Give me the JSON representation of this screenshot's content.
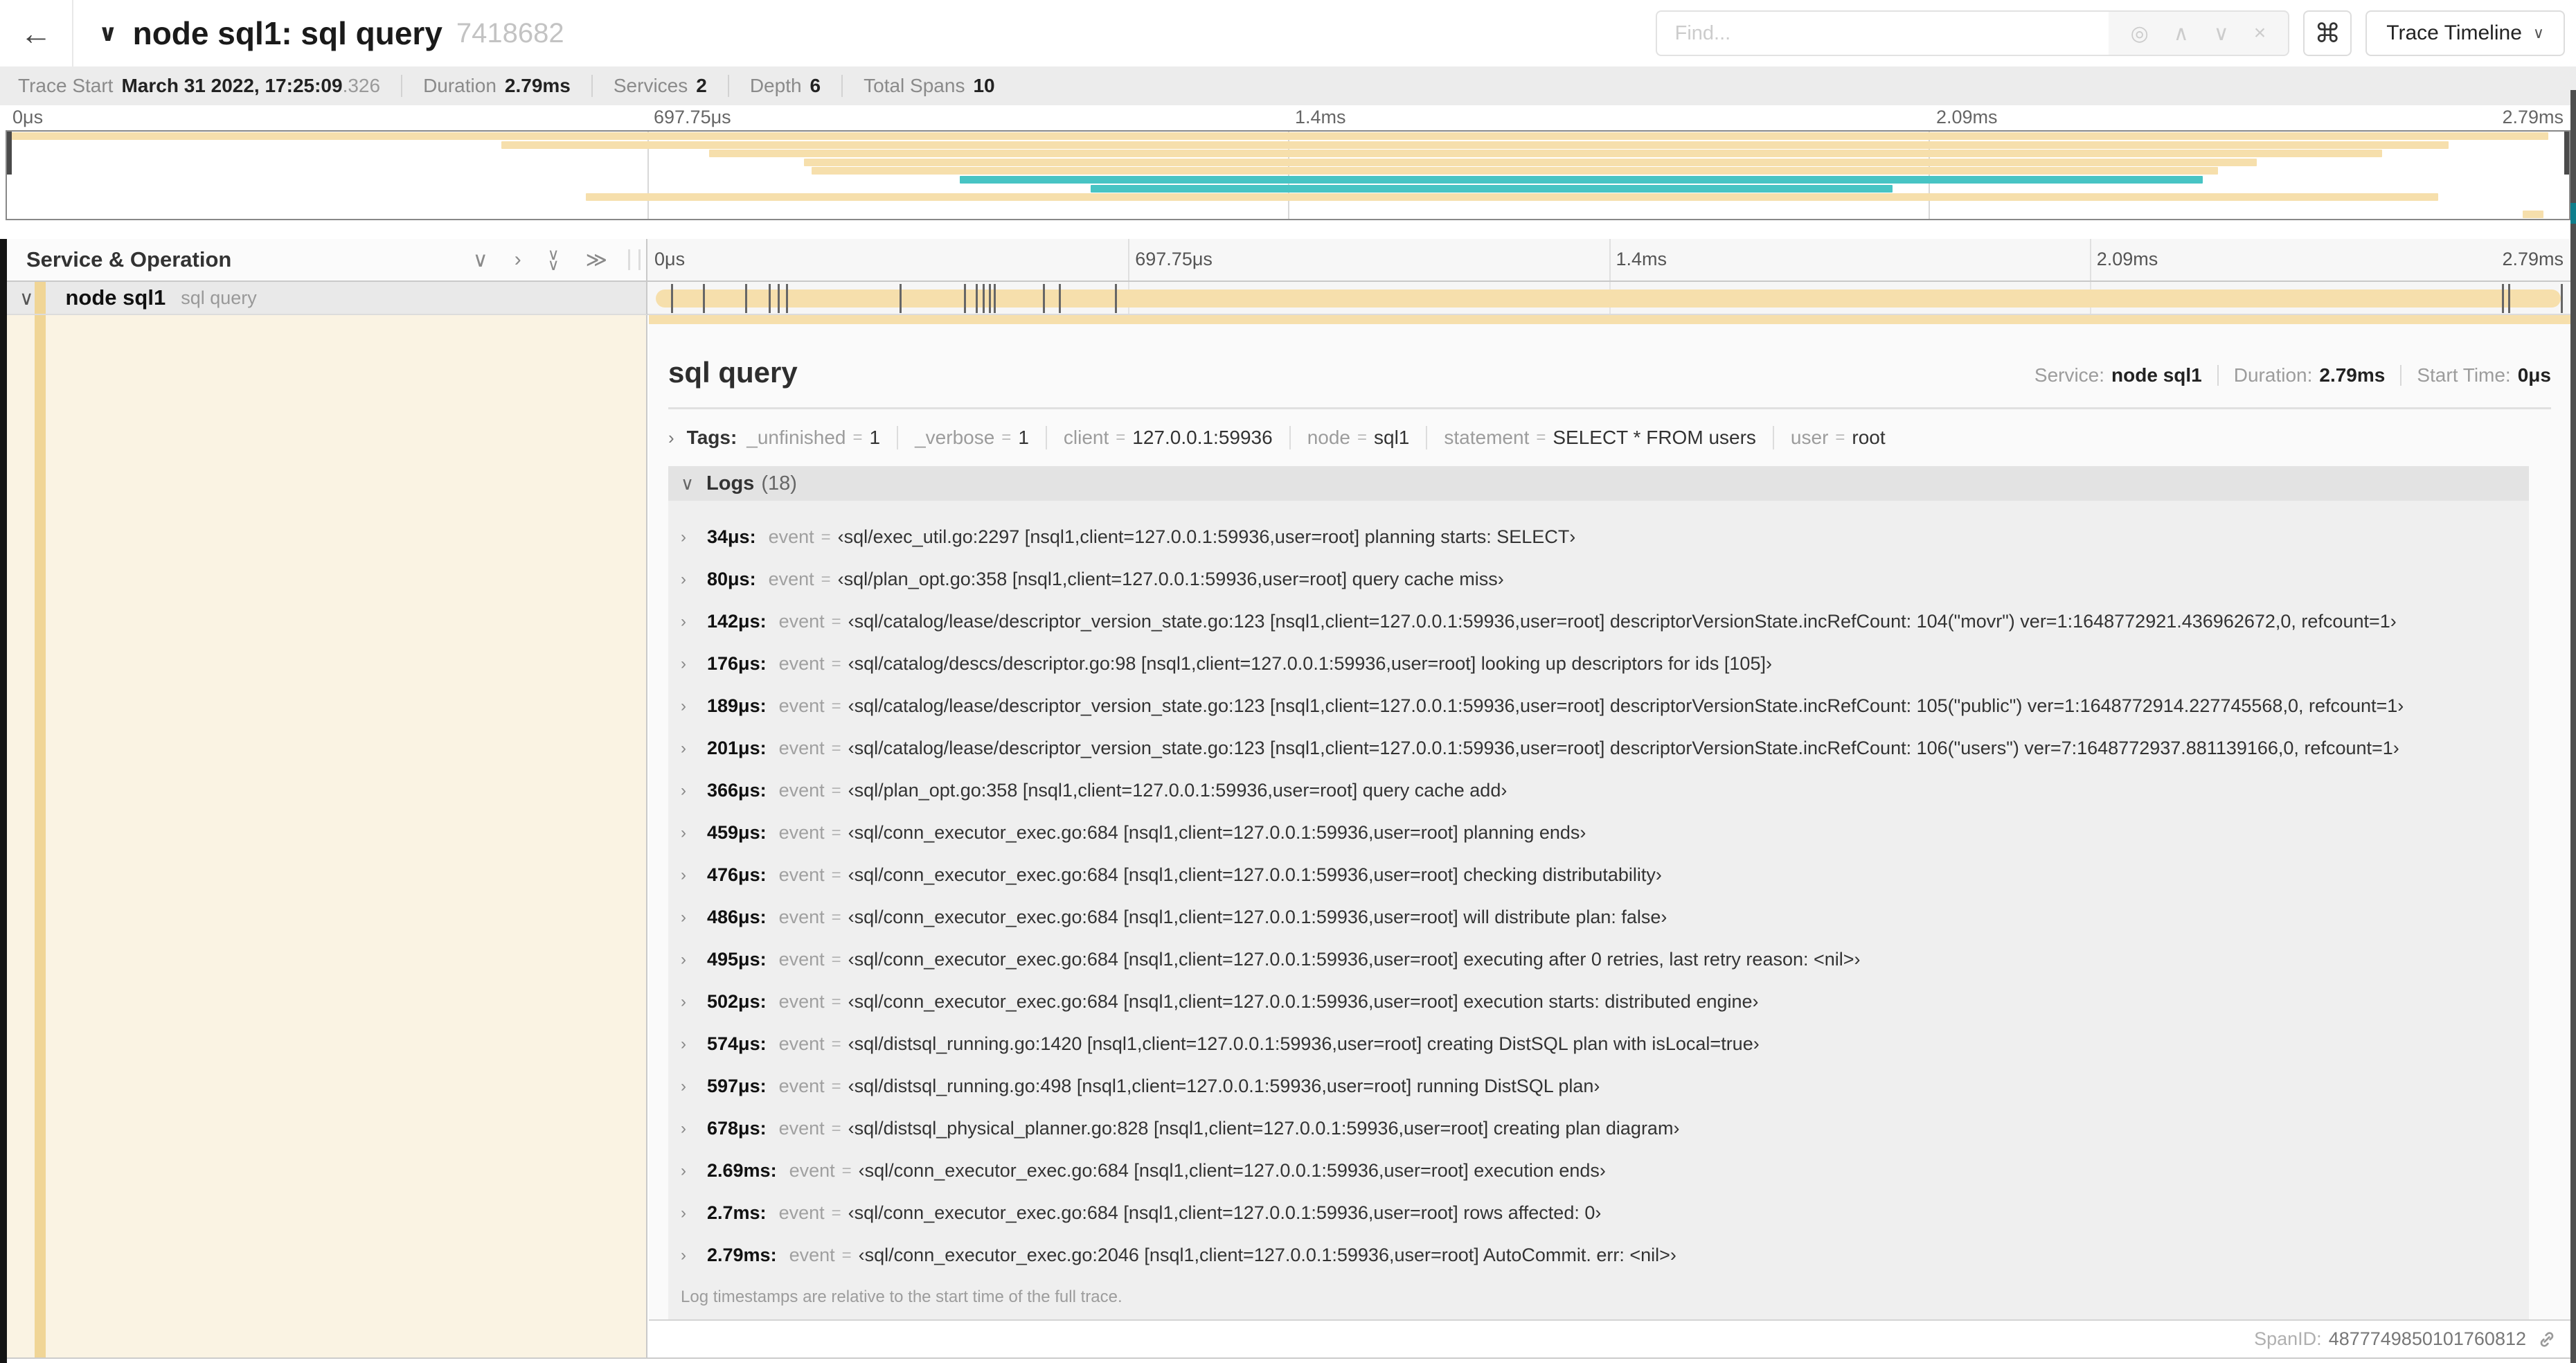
{
  "colors": {
    "tan": "#F6DFAC",
    "teal": "#47C4C4",
    "accent": "#F0D596",
    "cream": "#FAF3E3"
  },
  "header": {
    "back_icon": "←",
    "collapse_icon": "∨",
    "title": "node sql1: sql query",
    "trace_id": "7418682",
    "find_placeholder": "Find...",
    "icons": {
      "locate": "◎",
      "prev": "∧",
      "next": "∨",
      "clear": "×",
      "shortcut": "⌘"
    },
    "view_select": "Trace Timeline",
    "view_caret": "∨"
  },
  "stats": [
    {
      "label": "Trace Start",
      "value": "March 31 2022, 17:25:09",
      "suffix": ".326"
    },
    {
      "label": "Duration",
      "value": "2.79ms",
      "suffix": ""
    },
    {
      "label": "Services",
      "value": "2",
      "suffix": ""
    },
    {
      "label": "Depth",
      "value": "6",
      "suffix": ""
    },
    {
      "label": "Total Spans",
      "value": "10",
      "suffix": ""
    }
  ],
  "timeline": {
    "labels": [
      {
        "label": "0μs",
        "pct": 0
      },
      {
        "label": "697.75μs",
        "pct": 25
      },
      {
        "label": "1.4ms",
        "pct": 50
      },
      {
        "label": "2.09ms",
        "pct": 75
      },
      {
        "label": "2.79ms",
        "pct": 100
      }
    ],
    "grid": [
      {
        "pct": 25
      },
      {
        "pct": 50
      },
      {
        "pct": 75
      }
    ],
    "column_header": "Service & Operation",
    "icons": {
      "chevron_down": "∨",
      "chevron_right": "›",
      "double_chevron_right": "≫"
    }
  },
  "minimap": {
    "bars": [
      {
        "row": 0,
        "s": 0,
        "e": 99.2,
        "c": "tan"
      },
      {
        "row": 1,
        "s": 19.3,
        "e": 95.3,
        "c": "tan"
      },
      {
        "row": 2,
        "s": 27.4,
        "e": 92.7,
        "c": "tan"
      },
      {
        "row": 3,
        "s": 31.1,
        "e": 87.8,
        "c": "tan"
      },
      {
        "row": 4,
        "s": 31.4,
        "e": 86.3,
        "c": "tan"
      },
      {
        "row": 5,
        "s": 37.2,
        "e": 85.7,
        "c": "teal"
      },
      {
        "row": 6,
        "s": 42.3,
        "e": 73.6,
        "c": "teal"
      },
      {
        "row": 7,
        "s": 22.6,
        "e": 94.9,
        "c": "tan"
      },
      {
        "row": 9,
        "s": 98.2,
        "e": 99.0,
        "c": "tan"
      }
    ]
  },
  "span_row": {
    "chevron": "∨",
    "service": "node sql1",
    "operation": "sql query",
    "log_marks": [
      {
        "pct": 1.22
      },
      {
        "pct": 2.87
      },
      {
        "pct": 5.09
      },
      {
        "pct": 6.31
      },
      {
        "pct": 6.77
      },
      {
        "pct": 7.2
      },
      {
        "pct": 13.12
      },
      {
        "pct": 16.45
      },
      {
        "pct": 17.06
      },
      {
        "pct": 17.42
      },
      {
        "pct": 17.74
      },
      {
        "pct": 17.99
      },
      {
        "pct": 20.57
      },
      {
        "pct": 21.4
      },
      {
        "pct": 24.3
      },
      {
        "pct": 96.42
      },
      {
        "pct": 96.77
      },
      {
        "pct": 99.5
      }
    ]
  },
  "detail": {
    "title": "sql query",
    "stats": [
      {
        "label": "Service:",
        "value": "node sql1"
      },
      {
        "label": "Duration:",
        "value": "2.79ms"
      },
      {
        "label": "Start Time:",
        "value": "0μs"
      }
    ],
    "tags_chevron": "›",
    "tags_label": "Tags:",
    "tags": [
      {
        "k": "_unfinished",
        "eq": "=",
        "v": "1"
      },
      {
        "k": "_verbose",
        "eq": "=",
        "v": "1"
      },
      {
        "k": "client",
        "eq": "=",
        "v": "127.0.0.1:59936"
      },
      {
        "k": "node",
        "eq": "=",
        "v": "sql1"
      },
      {
        "k": "statement",
        "eq": "=",
        "v": "SELECT * FROM users"
      },
      {
        "k": "user",
        "eq": "=",
        "v": "root"
      }
    ],
    "logs_chevron": "∨",
    "logs_label": "Logs",
    "logs_count": "(18)",
    "log_key": "event",
    "logs": [
      {
        "t": "34μs:",
        "k": "event",
        "eq": "=",
        "v": "‹sql/exec_util.go:2297 [nsql1,client=127.0.0.1:59936,user=root] planning starts: SELECT›"
      },
      {
        "t": "80μs:",
        "k": "event",
        "eq": "=",
        "v": "‹sql/plan_opt.go:358 [nsql1,client=127.0.0.1:59936,user=root] query cache miss›"
      },
      {
        "t": "142μs:",
        "k": "event",
        "eq": "=",
        "v": "‹sql/catalog/lease/descriptor_version_state.go:123 [nsql1,client=127.0.0.1:59936,user=root] descriptorVersionState.incRefCount: 104(\"movr\") ver=1:1648772921.436962672,0, refcount=1›"
      },
      {
        "t": "176μs:",
        "k": "event",
        "eq": "=",
        "v": "‹sql/catalog/descs/descriptor.go:98 [nsql1,client=127.0.0.1:59936,user=root] looking up descriptors for ids [105]›"
      },
      {
        "t": "189μs:",
        "k": "event",
        "eq": "=",
        "v": "‹sql/catalog/lease/descriptor_version_state.go:123 [nsql1,client=127.0.0.1:59936,user=root] descriptorVersionState.incRefCount: 105(\"public\") ver=1:1648772914.227745568,0, refcount=1›"
      },
      {
        "t": "201μs:",
        "k": "event",
        "eq": "=",
        "v": "‹sql/catalog/lease/descriptor_version_state.go:123 [nsql1,client=127.0.0.1:59936,user=root] descriptorVersionState.incRefCount: 106(\"users\") ver=7:1648772937.881139166,0, refcount=1›"
      },
      {
        "t": "366μs:",
        "k": "event",
        "eq": "=",
        "v": "‹sql/plan_opt.go:358 [nsql1,client=127.0.0.1:59936,user=root] query cache add›"
      },
      {
        "t": "459μs:",
        "k": "event",
        "eq": "=",
        "v": "‹sql/conn_executor_exec.go:684 [nsql1,client=127.0.0.1:59936,user=root] planning ends›"
      },
      {
        "t": "476μs:",
        "k": "event",
        "eq": "=",
        "v": "‹sql/conn_executor_exec.go:684 [nsql1,client=127.0.0.1:59936,user=root] checking distributability›"
      },
      {
        "t": "486μs:",
        "k": "event",
        "eq": "=",
        "v": "‹sql/conn_executor_exec.go:684 [nsql1,client=127.0.0.1:59936,user=root] will distribute plan: false›"
      },
      {
        "t": "495μs:",
        "k": "event",
        "eq": "=",
        "v": "‹sql/conn_executor_exec.go:684 [nsql1,client=127.0.0.1:59936,user=root] executing after 0 retries, last retry reason: <nil>›"
      },
      {
        "t": "502μs:",
        "k": "event",
        "eq": "=",
        "v": "‹sql/conn_executor_exec.go:684 [nsql1,client=127.0.0.1:59936,user=root] execution starts: distributed engine›"
      },
      {
        "t": "574μs:",
        "k": "event",
        "eq": "=",
        "v": "‹sql/distsql_running.go:1420 [nsql1,client=127.0.0.1:59936,user=root] creating DistSQL plan with isLocal=true›"
      },
      {
        "t": "597μs:",
        "k": "event",
        "eq": "=",
        "v": "‹sql/distsql_running.go:498 [nsql1,client=127.0.0.1:59936,user=root] running DistSQL plan›"
      },
      {
        "t": "678μs:",
        "k": "event",
        "eq": "=",
        "v": "‹sql/distsql_physical_planner.go:828 [nsql1,client=127.0.0.1:59936,user=root] creating plan diagram›"
      },
      {
        "t": "2.69ms:",
        "k": "event",
        "eq": "=",
        "v": "‹sql/conn_executor_exec.go:684 [nsql1,client=127.0.0.1:59936,user=root] execution ends›"
      },
      {
        "t": "2.7ms:",
        "k": "event",
        "eq": "=",
        "v": "‹sql/conn_executor_exec.go:684 [nsql1,client=127.0.0.1:59936,user=root] rows affected: 0›"
      },
      {
        "t": "2.79ms:",
        "k": "event",
        "eq": "=",
        "v": "‹sql/conn_executor_exec.go:2046 [nsql1,client=127.0.0.1:59936,user=root] AutoCommit. err: <nil>›"
      }
    ],
    "logs_note": "Log timestamps are relative to the start time of the full trace.",
    "spanid_label": "SpanID:",
    "spanid": "4877749850101760812"
  }
}
